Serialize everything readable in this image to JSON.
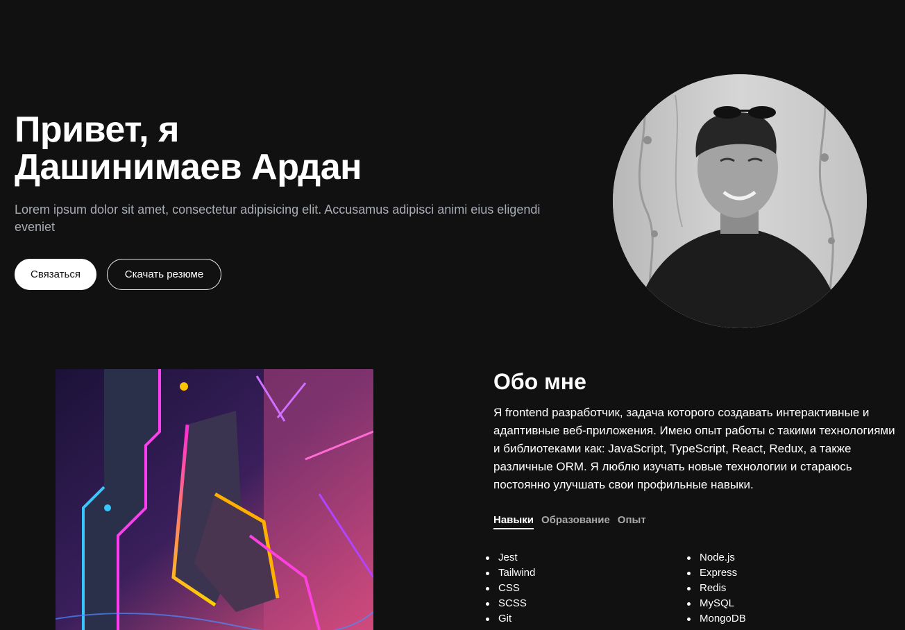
{
  "hero": {
    "title_line1": "Привет, я",
    "title_line2": "Дашинимаев Ардан",
    "subtitle": "Lorem ipsum dolor sit amet, consectetur adipisicing elit. Accusamus adipisci animi eius eligendi eveniet",
    "contact_button": "Связаться",
    "resume_button": "Скачать резюме"
  },
  "about": {
    "title": "Обо мне",
    "text": "Я frontend разработчик, задача которого создавать интерактивные и адаптивные веб-приложения. Имею опыт работы с такими технологиями и библиотеками как: JavaScript, TypeScript, React, Redux, а также различные ORM. Я люблю изучать новые технологии и стараюсь постоянно улучшать свои профильные навыки.",
    "tabs": [
      "Навыки",
      "Образование",
      "Опыт"
    ],
    "active_tab": "Навыки",
    "skills_left": [
      "Jest",
      "Tailwind",
      "CSS",
      "SCSS",
      "Git"
    ],
    "skills_right": [
      "Node.js",
      "Express",
      "Redis",
      "MySQL",
      "MongoDB"
    ]
  },
  "colors": {
    "background": "#111111",
    "subtitle_text": "#a8acb4",
    "inactive_tab": "#a9a9a9"
  }
}
